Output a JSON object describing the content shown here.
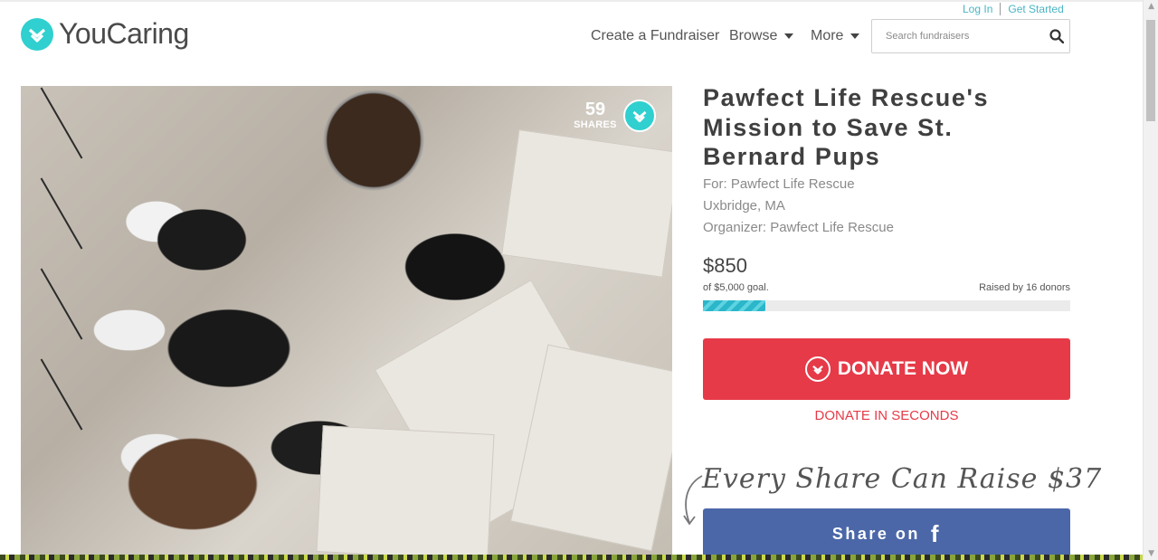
{
  "header": {
    "logo_text": "YouCaring",
    "auth": {
      "login": "Log In",
      "get_started": "Get Started"
    },
    "nav": {
      "create": "Create a Fundraiser",
      "browse": "Browse",
      "more": "More"
    },
    "search": {
      "placeholder": "Search fundraisers"
    }
  },
  "campaign": {
    "photo_alt": "St. Bernard puppies sleeping on newspapers",
    "shares": {
      "count": "59",
      "label": "SHARES"
    },
    "title": "Pawfect Life Rescue's Mission to Save St. Bernard Pups",
    "for": "For: Pawfect Life Rescue",
    "location": "Uxbridge, MA",
    "organizer": "Organizer: Pawfect Life Rescue",
    "amount": "$850",
    "goal": "of $5,000 goal.",
    "donors": "Raised by 16 donors",
    "progress_fraction": 0.17,
    "donate_label": "DONATE NOW",
    "donate_seconds": "DONATE IN SECONDS",
    "share_tagline": "Every Share Can Raise $37",
    "share_facebook": "Share on"
  },
  "colors": {
    "brand_teal": "#2fd0cf",
    "donate_red": "#e63a48",
    "facebook_blue": "#4b67a8",
    "link": "#4ab5c4"
  }
}
